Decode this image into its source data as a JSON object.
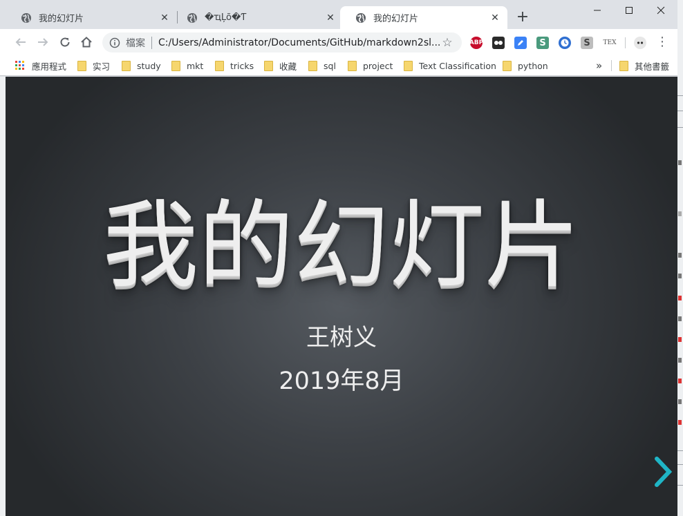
{
  "browser": {
    "tabs": [
      {
        "title": "我的幻灯片",
        "active": false
      },
      {
        "title": "�ҵĻõ�Ƭ",
        "active": false
      },
      {
        "title": "我的幻灯片",
        "active": true
      }
    ],
    "new_tab_symbol": "+",
    "window_controls": {
      "minimize": "—",
      "maximize": "☐",
      "close": "✕"
    },
    "nav": {
      "back_icon": "←",
      "forward_icon": "→",
      "reload_icon": "⟳",
      "home_icon": "⌂"
    },
    "omnibox": {
      "file_label": "檔案",
      "url": "C:/Users/Administrator/Documents/GitHub/markdown2sl...",
      "star_icon": "☆"
    },
    "extensions": [
      {
        "name": "abp-icon",
        "label": "ABP",
        "color": "#c70d2c"
      },
      {
        "name": "tampermonkey-icon",
        "label": "",
        "color": "#2a2a2a"
      },
      {
        "name": "edit-pen-icon",
        "label": "",
        "color": "#3b82f6"
      },
      {
        "name": "s-extension-icon",
        "label": "S",
        "color": "#4a9a7d"
      },
      {
        "name": "clock-icon",
        "label": "",
        "color": "#2f6fd1"
      },
      {
        "name": "s-gray-extension-icon",
        "label": "S",
        "color": "#bdbdbd"
      },
      {
        "name": "tex-icon",
        "label": "TEX",
        "color": "#ffffff"
      },
      {
        "name": "face-icon",
        "label": "",
        "color": "#e7e7e7"
      }
    ],
    "menu_icon": "⋮",
    "bookmarks": [
      {
        "label": "應用程式",
        "type": "apps"
      },
      {
        "label": "实习",
        "type": "folder"
      },
      {
        "label": "study",
        "type": "folder"
      },
      {
        "label": "mkt",
        "type": "folder"
      },
      {
        "label": "tricks",
        "type": "folder"
      },
      {
        "label": "收藏",
        "type": "folder"
      },
      {
        "label": "sql",
        "type": "folder"
      },
      {
        "label": "project",
        "type": "folder"
      },
      {
        "label": "Text Classification",
        "type": "folder"
      },
      {
        "label": "python",
        "type": "folder"
      }
    ],
    "bookmarks_overflow": "»",
    "other_bookmarks": "其他書籤"
  },
  "slide": {
    "title": "我的幻灯片",
    "author": "王树义",
    "date": "2019年8月",
    "accent_color": "#1fb5c6"
  }
}
